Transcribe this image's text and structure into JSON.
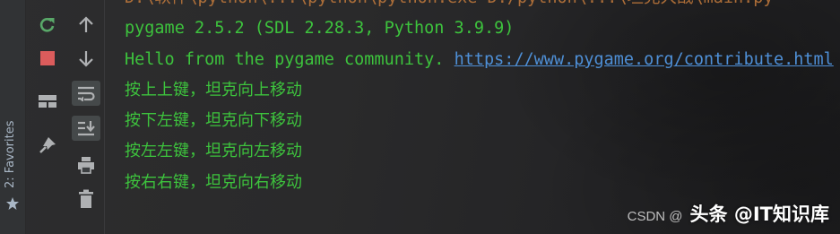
{
  "sidebar": {
    "favorites_label": "2: Favorites"
  },
  "toolbar": {
    "left_column": [
      "rerun-icon",
      "stop-icon",
      "layout-icon",
      "pin-icon"
    ],
    "right_column": [
      "arrow-up-icon",
      "arrow-down-icon",
      "soft-wrap-icon",
      "scroll-to-end-icon",
      "print-icon",
      "trash-icon"
    ]
  },
  "console": {
    "cut_line": "D:\\软件\\python\\...\\python\\python.exe  D:/python\\...\\坦克大战\\main.py",
    "lines": [
      "pygame 2.5.2 (SDL 2.28.3, Python 3.9.9)",
      "Hello from the pygame community.",
      "按上上键，坦克向上移动",
      "按下左键，坦克向下移动",
      "按左左键，坦克向左移动",
      "按右右键，坦克向右移动"
    ],
    "link": "https://www.pygame.org/contribute.html"
  },
  "watermark": {
    "csdn": "CSDN @",
    "main": "头条 @IT知识库"
  },
  "colors": {
    "output_green": "#3dc33d",
    "link_blue": "#4e8fd6",
    "background": "#2b2b2b"
  }
}
